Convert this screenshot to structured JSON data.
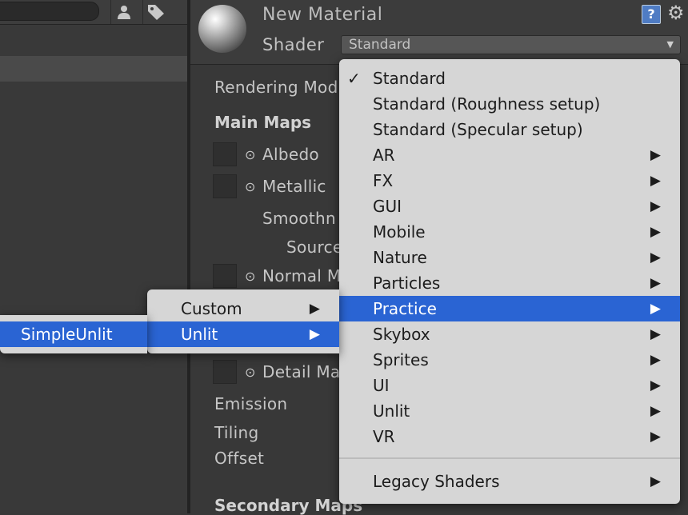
{
  "material": {
    "name": "New Material",
    "shader_label": "Shader",
    "shader_value": "Standard"
  },
  "inspector": {
    "rendering_mode_label": "Rendering Mod",
    "main_maps_header": "Main Maps",
    "albedo_label": "Albedo",
    "metallic_label": "Metallic",
    "smoothness_label": "Smoothn",
    "source_label": "Source",
    "normal_map_label": "Normal M",
    "detail_mask_label": "Detail Ma",
    "emission_label": "Emission",
    "tiling_label": "Tiling",
    "offset_label": "Offset",
    "secondary_maps_header": "Secondary Maps"
  },
  "menu": {
    "check_glyph": "✓",
    "items": [
      "Standard",
      "Standard (Roughness setup)",
      "Standard (Specular setup)",
      "AR",
      "FX",
      "GUI",
      "Mobile",
      "Nature",
      "Particles",
      "Practice",
      "Skybox",
      "Sprites",
      "UI",
      "Unlit",
      "VR"
    ],
    "legacy": "Legacy Shaders",
    "selected": "Standard",
    "highlighted": "Practice"
  },
  "submenu": {
    "items": [
      "Custom",
      "Unlit"
    ],
    "highlighted": "Unlit"
  },
  "submenu2": {
    "items": [
      "SimpleUnlit"
    ],
    "highlighted": "SimpleUnlit"
  },
  "colors": {
    "highlight": "#2a64d3",
    "menu_bg": "#d6d6d6",
    "panel_bg": "#383838"
  },
  "icons": [
    "search-field",
    "person-icon",
    "tag-icon",
    "help-icon",
    "settings-icon",
    "picker-icon",
    "chevron-right-icon"
  ]
}
